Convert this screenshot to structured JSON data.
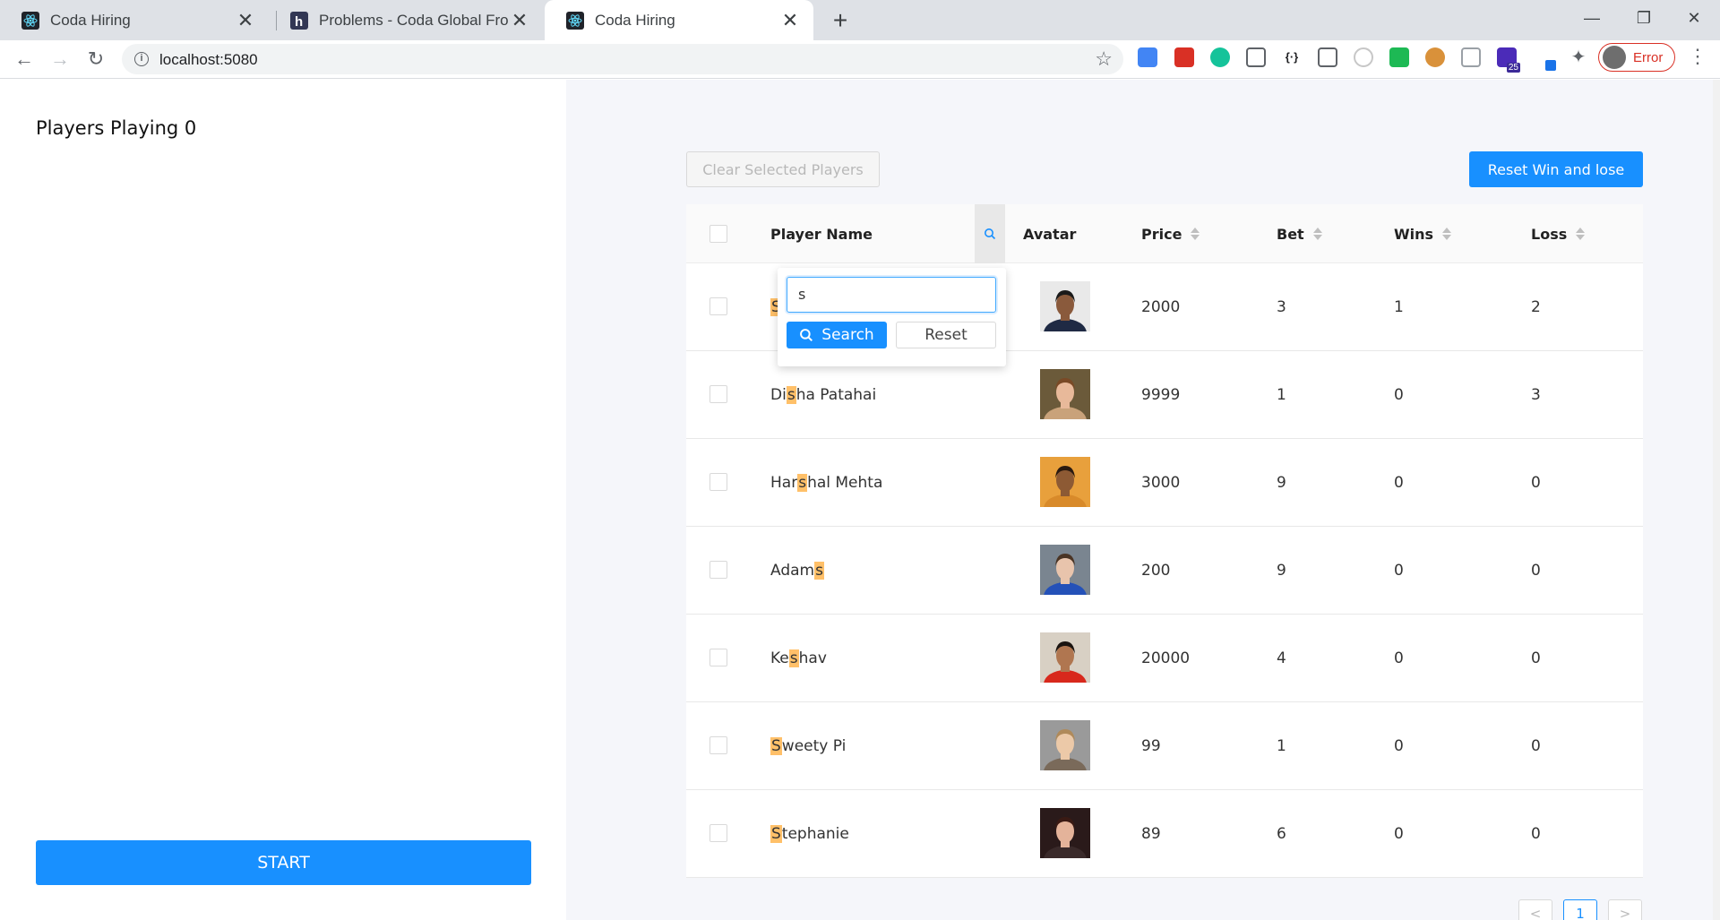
{
  "browser": {
    "tabs": [
      {
        "title": "Coda Hiring",
        "active": false,
        "icon": "react-logo-icon"
      },
      {
        "title": "Problems - Coda Global Frontend",
        "active": false,
        "icon": "hackerearth-h-icon"
      },
      {
        "title": "Coda Hiring",
        "active": true,
        "icon": "react-logo-icon"
      }
    ],
    "new_tab": "+",
    "url": "localhost:5080",
    "profile_status": "Error",
    "extension_badge": "25"
  },
  "left_panel": {
    "players_playing_label": "Players Playing 0",
    "start_label": "START"
  },
  "toolbar": {
    "clear_selected_label": "Clear Selected Players",
    "reset_win_lose_label": "Reset Win and lose"
  },
  "table": {
    "headers": {
      "player_name": "Player Name",
      "avatar": "Avatar",
      "price": "Price",
      "bet": "Bet",
      "wins": "Wins",
      "loss": "Loss"
    },
    "rows": [
      {
        "name_pre": "",
        "name_hl": "S",
        "name_post": "",
        "price": "2000",
        "bet": "3",
        "wins": "1",
        "loss": "2"
      },
      {
        "name_pre": "Di",
        "name_hl": "s",
        "name_post": "ha Patahai",
        "price": "9999",
        "bet": "1",
        "wins": "0",
        "loss": "3"
      },
      {
        "name_pre": "Har",
        "name_hl": "s",
        "name_post": "hal Mehta",
        "price": "3000",
        "bet": "9",
        "wins": "0",
        "loss": "0"
      },
      {
        "name_pre": "Adam",
        "name_hl": "s",
        "name_post": "",
        "price": "200",
        "bet": "9",
        "wins": "0",
        "loss": "0"
      },
      {
        "name_pre": "Ke",
        "name_hl": "s",
        "name_post": "hav",
        "price": "20000",
        "bet": "4",
        "wins": "0",
        "loss": "0"
      },
      {
        "name_pre": "",
        "name_hl": "S",
        "name_post": "weety Pi",
        "price": "99",
        "bet": "1",
        "wins": "0",
        "loss": "0"
      },
      {
        "name_pre": "",
        "name_hl": "S",
        "name_post": "tephanie",
        "price": "89",
        "bet": "6",
        "wins": "0",
        "loss": "0"
      }
    ]
  },
  "filter_dropdown": {
    "input_value": "s",
    "search_label": "Search",
    "reset_label": "Reset"
  },
  "pagination": {
    "prev": "<",
    "current": "1",
    "next": ">"
  },
  "colors": {
    "primary": "#1890ff",
    "highlight": "#ffc069"
  }
}
